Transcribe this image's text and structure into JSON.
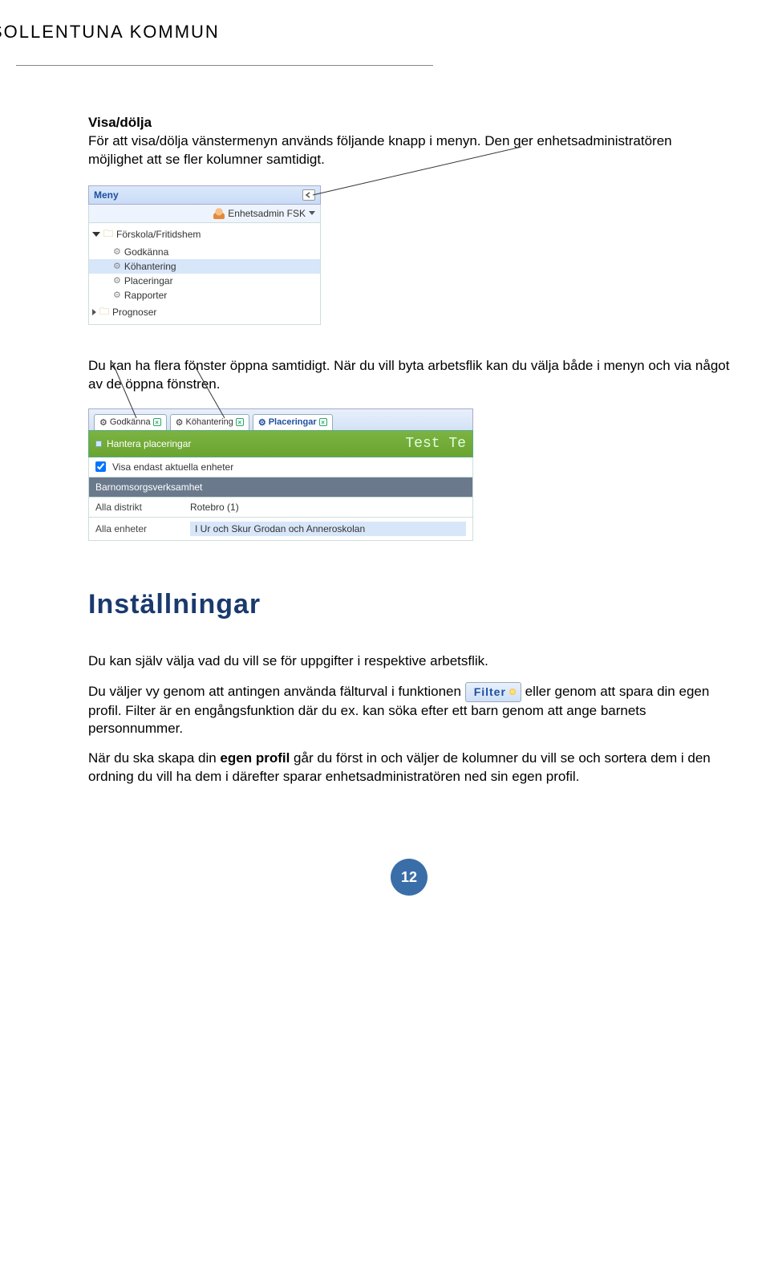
{
  "header": {
    "org": "SOLLENTUNA KOMMUN"
  },
  "section1": {
    "title": "Visa/dölja",
    "p1": "För att visa/dölja vänstermenyn används följande knapp i menyn. Den ger enhetsadministratören möjlighet att se fler kolumner samtidigt."
  },
  "menu": {
    "title": "Meny",
    "role": "Enhetsadmin FSK",
    "items": [
      {
        "label": "Förskola/Fritidshem",
        "type": "folder",
        "expanded": true
      },
      {
        "label": "Godkänna",
        "type": "gear"
      },
      {
        "label": "Köhantering",
        "type": "gear",
        "selected": true
      },
      {
        "label": "Placeringar",
        "type": "gear"
      },
      {
        "label": "Rapporter",
        "type": "gear"
      },
      {
        "label": "Prognoser",
        "type": "folder",
        "expanded": false
      }
    ]
  },
  "section2": {
    "p1": "Du kan ha flera fönster öppna samtidigt. När du vill byta arbetsflik kan du välja både i menyn och via något av de öppna fönstren."
  },
  "tabs_view": {
    "tabs": [
      {
        "label": "Godkänna"
      },
      {
        "label": "Köhantering"
      },
      {
        "label": "Placeringar",
        "active": true
      }
    ],
    "greenbar_left": "Hantera placeringar",
    "greenbar_right": "Test Te",
    "checkbox_label": "Visa endast aktuella enheter",
    "dark_row": "Barnomsorgsverksamhet",
    "row1_label": "Alla distrikt",
    "row1_value": "Rotebro (1)",
    "row2_label": "Alla enheter",
    "row2_value": "I Ur och Skur Grodan och Anneroskolan"
  },
  "h2": "Inställningar",
  "section3": {
    "p1": "Du kan själv välja vad du vill se för uppgifter i respektive arbetsflik.",
    "p2a": "Du väljer vy genom att antingen använda fälturval i funktionen ",
    "filter_label": "Filter",
    "p2b": " eller genom att spara din egen profil. Filter är en engångsfunktion där du ex. kan söka efter ett barn genom att ange barnets personnummer.",
    "p3a": "När du ska skapa din ",
    "p3_bold": "egen profil",
    "p3b": " går du först in och väljer de kolumner du vill se och sortera dem i den ordning du vill ha dem i därefter sparar enhetsadministratören ned sin egen profil."
  },
  "page_number": "12"
}
